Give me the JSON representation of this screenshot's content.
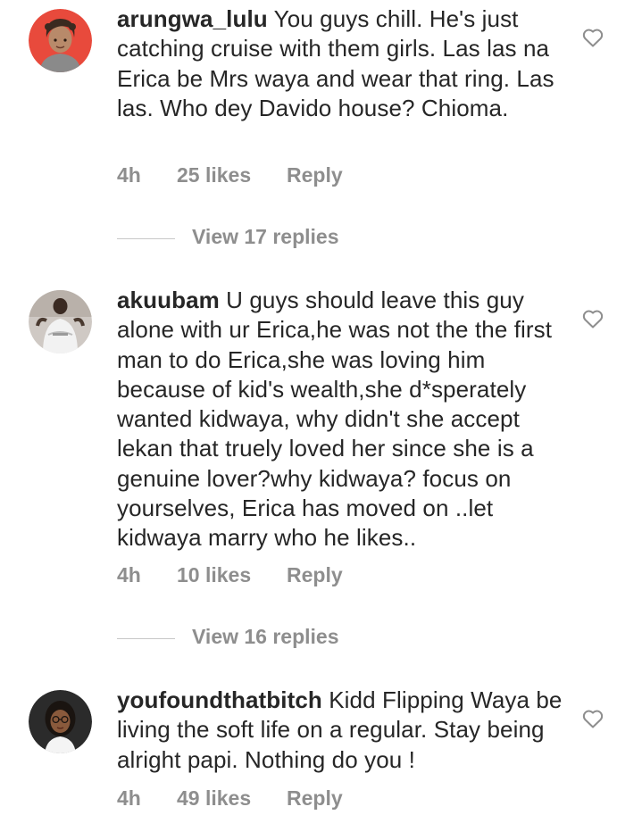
{
  "comments": [
    {
      "username": "arungwa_lulu",
      "text": "You guys chill. He's just catching cruise with them girls. Las las na Erica be Mrs waya and wear that ring. Las las. Who dey Davido house? Chioma.",
      "time": "4h",
      "likes": "25 likes",
      "reply": "Reply",
      "view_replies": "View 17 replies",
      "like_icon": "heart-outline-icon"
    },
    {
      "username": "akuubam",
      "text": "U guys should leave this guy alone with ur Erica,he was not the the first man to do Erica,she was loving him because of kid's wealth,she d*sperately wanted kidwaya, why didn't she accept lekan that truely loved her since she is a genuine lover?why kidwaya? focus on yourselves, Erica has moved on ..let kidwaya marry who he likes..",
      "time": "4h",
      "likes": "10 likes",
      "reply": "Reply",
      "view_replies": "View 16 replies",
      "like_icon": "heart-outline-icon"
    },
    {
      "username": "youfoundthatbitch",
      "text": "Kidd Flipping Waya be living the soft life on a regular. Stay being alright papi. Nothing do you !",
      "time": "4h",
      "likes": "49 likes",
      "reply": "Reply",
      "like_icon": "heart-outline-icon"
    }
  ],
  "colors": {
    "text": "#262626",
    "secondary": "#8e8e8e",
    "divider": "#c7c7c7",
    "avatar1_bg": "#e84a3c"
  }
}
